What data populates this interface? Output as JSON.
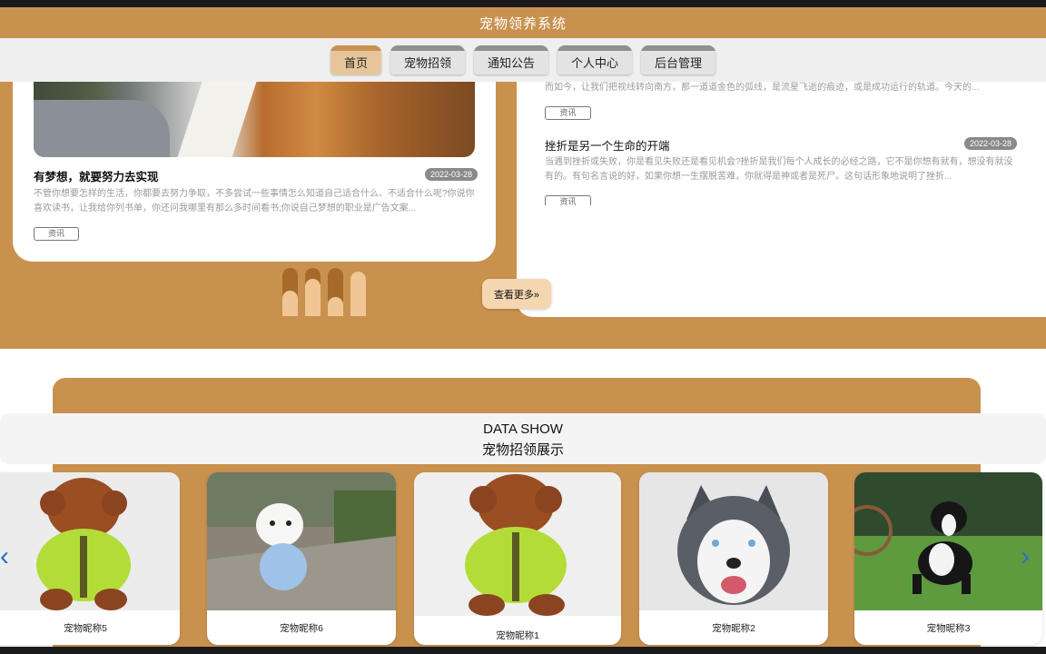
{
  "header": {
    "title": "宠物领养系统"
  },
  "nav": {
    "tabs": [
      "首页",
      "宠物招领",
      "通知公告",
      "个人中心",
      "后台管理"
    ]
  },
  "news_left": {
    "title": "有梦想，就要努力去实现",
    "date": "2022-03-28",
    "text": "不管你想要怎样的生活，你都要去努力争取，不多尝试一些事情怎么知道自己适合什么、不适合什么呢?你说你喜欢读书，让我给你列书单，你还问我哪里有那么多时间看书;你说自己梦想的职业是广告文案...",
    "tag": "资讯"
  },
  "news_right": [
    {
      "title": "",
      "date": "",
      "text": "而如今，让我们把视线转向南方，那一道道金色的弧线，是流星飞逝的痕迹，或是成功运行的轨道。今天的...",
      "tag": "资讯"
    },
    {
      "title": "挫折是另一个生命的开端",
      "date": "2022-03-28",
      "text": "当遇到挫折或失败，你是看见失败还是看见机会?挫折是我们每个人成长的必经之路，它不是你想有就有，想没有就没有的。有句名言说的好，如果你想一生摆脱苦难，你就得是神或者是死尸。这句话形象地说明了挫折...",
      "tag": "资讯"
    }
  ],
  "more_button": "查看更多»",
  "show": {
    "title_en": "DATA SHOW",
    "title_cn": "宠物招领展示"
  },
  "pets": [
    {
      "name": "宠物昵称5",
      "kind": "poodle"
    },
    {
      "name": "宠物昵称6",
      "kind": "white-dog"
    },
    {
      "name": "宠物昵称1",
      "kind": "poodle"
    },
    {
      "name": "宠物昵称2",
      "kind": "husky"
    },
    {
      "name": "宠物昵称3",
      "kind": "border-collie"
    }
  ],
  "arrows": {
    "prev": "‹",
    "next": "›"
  },
  "colors": {
    "brand": "#c9914e",
    "light": "#f4d6b0",
    "arrow": "#2d6fc4"
  }
}
